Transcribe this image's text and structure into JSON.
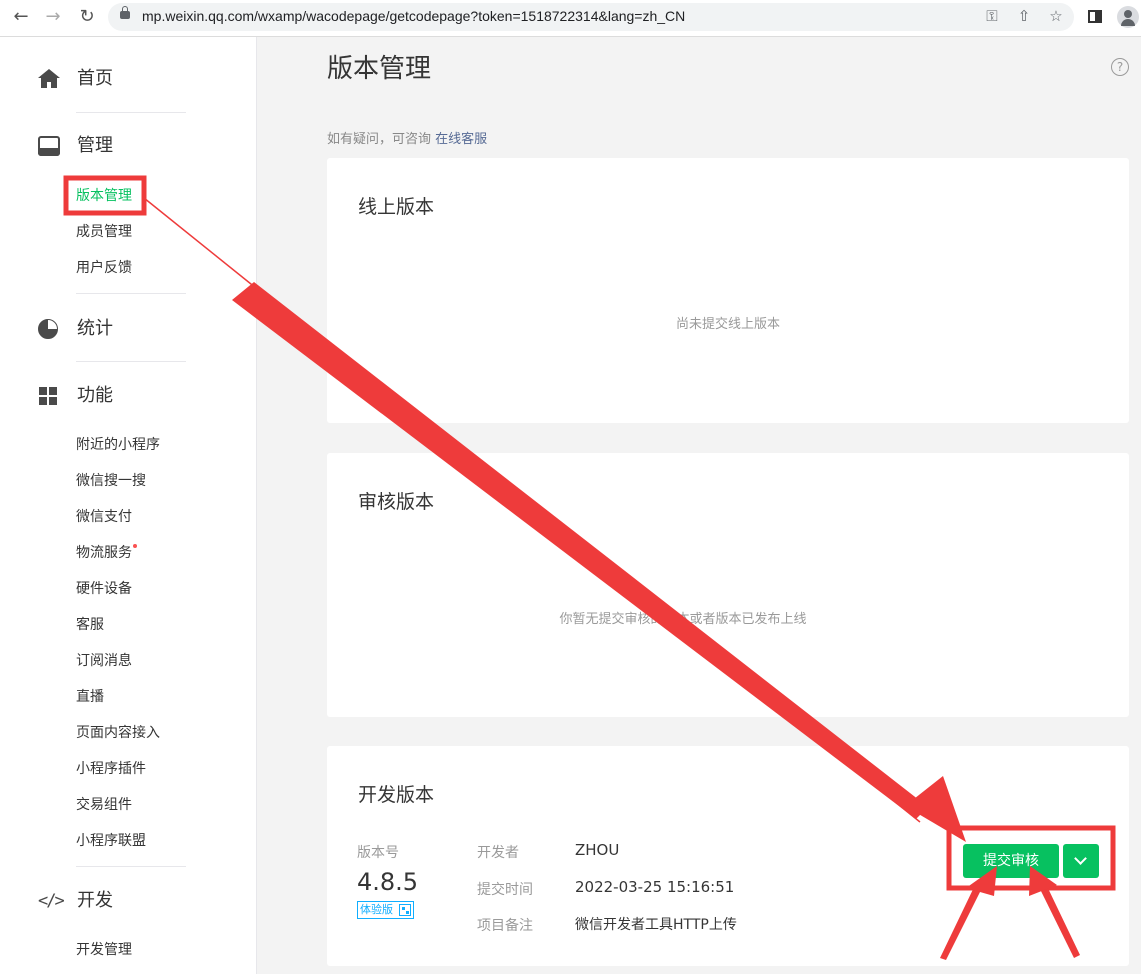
{
  "browser": {
    "url": "mp.weixin.qq.com/wxamp/wacodepage/getcodepage?token=1518722314&lang=zh_CN",
    "icons": [
      "back-icon",
      "forward-icon",
      "reload-icon",
      "lock-icon",
      "key-icon",
      "share-icon",
      "star-icon",
      "side-panel-icon",
      "profile-icon"
    ]
  },
  "sidebar": {
    "home": "首页",
    "manage": {
      "label": "管理",
      "items": [
        "版本管理",
        "成员管理",
        "用户反馈"
      ]
    },
    "stats": "统计",
    "features": {
      "label": "功能",
      "items": [
        "附近的小程序",
        "微信搜一搜",
        "微信支付",
        "物流服务",
        "硬件设备",
        "客服",
        "订阅消息",
        "直播",
        "页面内容接入",
        "小程序插件",
        "交易组件",
        "小程序联盟"
      ]
    },
    "dev": {
      "label": "开发",
      "items": [
        "开发管理"
      ]
    }
  },
  "main": {
    "title": "版本管理",
    "hint_prefix": "如有疑问，可咨询",
    "hint_link": "在线客服",
    "online": {
      "title": "线上版本",
      "empty": "尚未提交线上版本"
    },
    "review": {
      "title": "审核版本",
      "empty": "你暂无提交审核的版本或者版本已发布上线"
    },
    "dev": {
      "title": "开发版本",
      "version_label": "版本号",
      "version": "4.8.5",
      "badge": "体验版",
      "developer_label": "开发者",
      "developer": "ZHOU",
      "time_label": "提交时间",
      "time": "2022-03-25 15:16:51",
      "note_label": "项目备注",
      "note": "微信开发者工具HTTP上传",
      "submit_label": "提交审核"
    }
  },
  "colors": {
    "accent": "#07c160",
    "link": "#576b95",
    "annotation": "#ee3b3b"
  }
}
